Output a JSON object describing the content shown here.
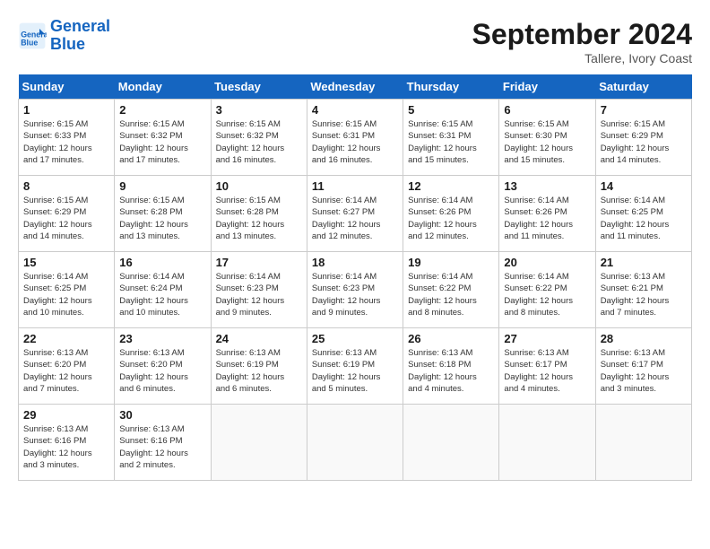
{
  "header": {
    "logo_line1": "General",
    "logo_line2": "Blue",
    "month_title": "September 2024",
    "location": "Tallere, Ivory Coast"
  },
  "days_of_week": [
    "Sunday",
    "Monday",
    "Tuesday",
    "Wednesday",
    "Thursday",
    "Friday",
    "Saturday"
  ],
  "weeks": [
    [
      {
        "day": "1",
        "sunrise": "6:15 AM",
        "sunset": "6:33 PM",
        "daylight": "12 hours and 17 minutes."
      },
      {
        "day": "2",
        "sunrise": "6:15 AM",
        "sunset": "6:32 PM",
        "daylight": "12 hours and 17 minutes."
      },
      {
        "day": "3",
        "sunrise": "6:15 AM",
        "sunset": "6:32 PM",
        "daylight": "12 hours and 16 minutes."
      },
      {
        "day": "4",
        "sunrise": "6:15 AM",
        "sunset": "6:31 PM",
        "daylight": "12 hours and 16 minutes."
      },
      {
        "day": "5",
        "sunrise": "6:15 AM",
        "sunset": "6:31 PM",
        "daylight": "12 hours and 15 minutes."
      },
      {
        "day": "6",
        "sunrise": "6:15 AM",
        "sunset": "6:30 PM",
        "daylight": "12 hours and 15 minutes."
      },
      {
        "day": "7",
        "sunrise": "6:15 AM",
        "sunset": "6:29 PM",
        "daylight": "12 hours and 14 minutes."
      }
    ],
    [
      {
        "day": "8",
        "sunrise": "6:15 AM",
        "sunset": "6:29 PM",
        "daylight": "12 hours and 14 minutes."
      },
      {
        "day": "9",
        "sunrise": "6:15 AM",
        "sunset": "6:28 PM",
        "daylight": "12 hours and 13 minutes."
      },
      {
        "day": "10",
        "sunrise": "6:15 AM",
        "sunset": "6:28 PM",
        "daylight": "12 hours and 13 minutes."
      },
      {
        "day": "11",
        "sunrise": "6:14 AM",
        "sunset": "6:27 PM",
        "daylight": "12 hours and 12 minutes."
      },
      {
        "day": "12",
        "sunrise": "6:14 AM",
        "sunset": "6:26 PM",
        "daylight": "12 hours and 12 minutes."
      },
      {
        "day": "13",
        "sunrise": "6:14 AM",
        "sunset": "6:26 PM",
        "daylight": "12 hours and 11 minutes."
      },
      {
        "day": "14",
        "sunrise": "6:14 AM",
        "sunset": "6:25 PM",
        "daylight": "12 hours and 11 minutes."
      }
    ],
    [
      {
        "day": "15",
        "sunrise": "6:14 AM",
        "sunset": "6:25 PM",
        "daylight": "12 hours and 10 minutes."
      },
      {
        "day": "16",
        "sunrise": "6:14 AM",
        "sunset": "6:24 PM",
        "daylight": "12 hours and 10 minutes."
      },
      {
        "day": "17",
        "sunrise": "6:14 AM",
        "sunset": "6:23 PM",
        "daylight": "12 hours and 9 minutes."
      },
      {
        "day": "18",
        "sunrise": "6:14 AM",
        "sunset": "6:23 PM",
        "daylight": "12 hours and 9 minutes."
      },
      {
        "day": "19",
        "sunrise": "6:14 AM",
        "sunset": "6:22 PM",
        "daylight": "12 hours and 8 minutes."
      },
      {
        "day": "20",
        "sunrise": "6:14 AM",
        "sunset": "6:22 PM",
        "daylight": "12 hours and 8 minutes."
      },
      {
        "day": "21",
        "sunrise": "6:13 AM",
        "sunset": "6:21 PM",
        "daylight": "12 hours and 7 minutes."
      }
    ],
    [
      {
        "day": "22",
        "sunrise": "6:13 AM",
        "sunset": "6:20 PM",
        "daylight": "12 hours and 7 minutes."
      },
      {
        "day": "23",
        "sunrise": "6:13 AM",
        "sunset": "6:20 PM",
        "daylight": "12 hours and 6 minutes."
      },
      {
        "day": "24",
        "sunrise": "6:13 AM",
        "sunset": "6:19 PM",
        "daylight": "12 hours and 6 minutes."
      },
      {
        "day": "25",
        "sunrise": "6:13 AM",
        "sunset": "6:19 PM",
        "daylight": "12 hours and 5 minutes."
      },
      {
        "day": "26",
        "sunrise": "6:13 AM",
        "sunset": "6:18 PM",
        "daylight": "12 hours and 4 minutes."
      },
      {
        "day": "27",
        "sunrise": "6:13 AM",
        "sunset": "6:17 PM",
        "daylight": "12 hours and 4 minutes."
      },
      {
        "day": "28",
        "sunrise": "6:13 AM",
        "sunset": "6:17 PM",
        "daylight": "12 hours and 3 minutes."
      }
    ],
    [
      {
        "day": "29",
        "sunrise": "6:13 AM",
        "sunset": "6:16 PM",
        "daylight": "12 hours and 3 minutes."
      },
      {
        "day": "30",
        "sunrise": "6:13 AM",
        "sunset": "6:16 PM",
        "daylight": "12 hours and 2 minutes."
      },
      null,
      null,
      null,
      null,
      null
    ]
  ]
}
